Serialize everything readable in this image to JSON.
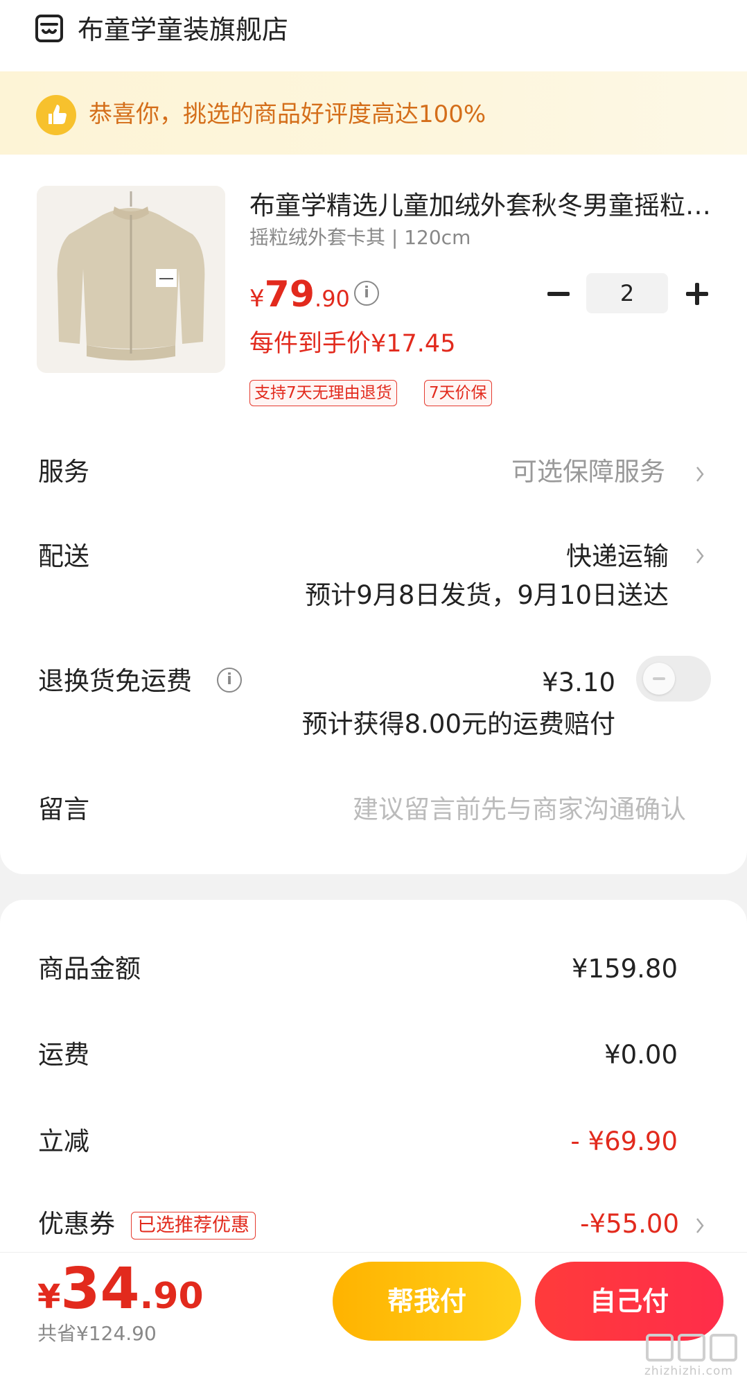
{
  "store": {
    "name": "布童学童装旗舰店",
    "icon": "store-icon"
  },
  "banner": {
    "text": "恭喜你，挑选的商品好评度高达100%",
    "icon": "thumbs-up-icon"
  },
  "product": {
    "title": "布童学精选儿童加绒外套秋冬男童摇粒绒外套",
    "spec": "摇粒绒外套卡其 | 120cm",
    "price_currency": "¥",
    "price_int": "79",
    "price_dec": ".90",
    "unit_price": "每件到手价¥17.45",
    "tags": [
      "支持7天无理由退货",
      "7天价保"
    ],
    "quantity": "2"
  },
  "rows": {
    "service": {
      "label": "服务",
      "value": "可选保障服务"
    },
    "delivery": {
      "label": "配送",
      "value": "快递运输",
      "estimate": "预计9月8日发货，9月10日送达"
    },
    "return_shipping": {
      "label": "退换货免运费",
      "price": "¥3.10",
      "note": "预计获得8.00元的运费赔付",
      "enabled": false
    },
    "message": {
      "label": "留言",
      "placeholder": "建议留言前先与商家沟通确认"
    }
  },
  "summary": {
    "goods_amount": {
      "label": "商品金额",
      "value": "¥159.80"
    },
    "shipping": {
      "label": "运费",
      "value": "¥0.00"
    },
    "discount": {
      "label": "立减",
      "value": "- ¥69.90"
    },
    "coupon": {
      "label": "优惠券",
      "tag": "已选推荐优惠",
      "value": "-¥55.00"
    }
  },
  "bottom": {
    "total_currency": "¥",
    "total_int": "34",
    "total_dec": ".90",
    "saved": "共省¥124.90",
    "help_pay": "帮我付",
    "self_pay": "自己付"
  },
  "watermark": {
    "text": "zhizhizhi.com"
  },
  "colors": {
    "accent_red": "#e22a1d",
    "banner_orange": "#d46e1a",
    "btn_yellow": "#ffb300",
    "btn_red": "#ff3b3b"
  }
}
